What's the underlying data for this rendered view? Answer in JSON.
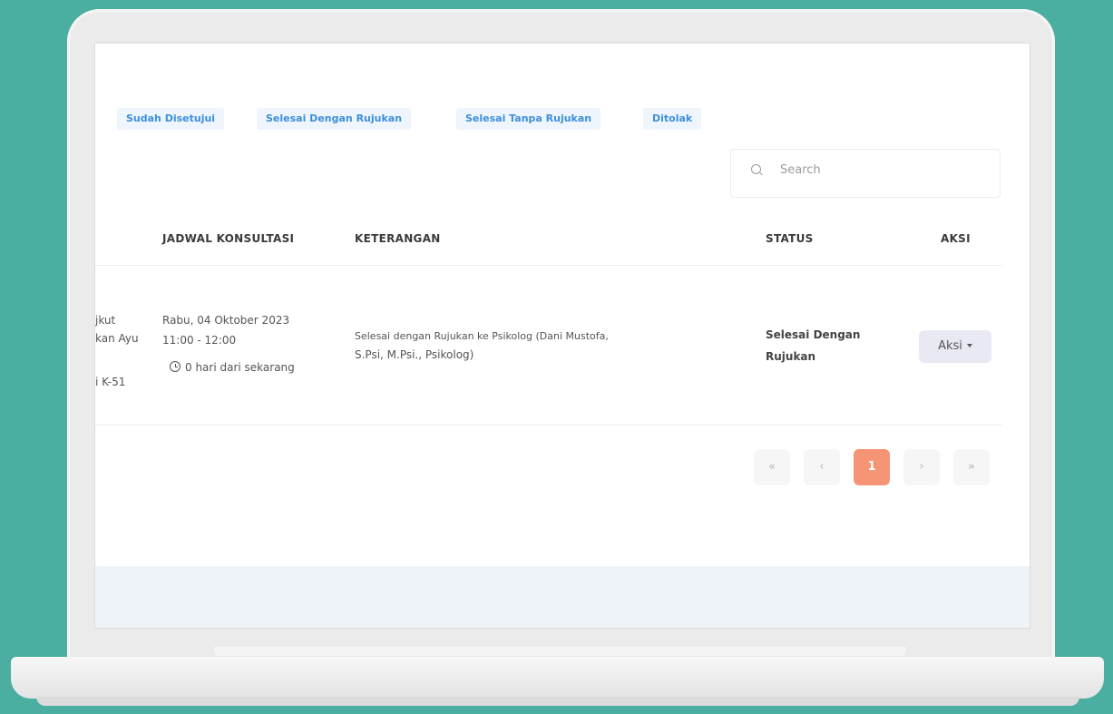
{
  "tabs": [
    "Sudah Disetujui",
    "Selesai Dengan Rujukan",
    "Selesai Tanpa Rujukan",
    "Ditolak"
  ],
  "search": {
    "placeholder": "Search",
    "icon": "search-icon"
  },
  "table": {
    "columns": [
      "JADWAL KONSULTASI",
      "KETERANGAN",
      "STATUS",
      "AKSI"
    ],
    "rows": [
      {
        "partial_left": [
          "jkut",
          "kan Ayu",
          "i K-51"
        ],
        "jadwal_date": "Rabu, 04 Oktober 2023",
        "jadwal_time": "11:00 - 12:00",
        "jadwal_relative": "0 hari dari sekarang",
        "keterangan_line1": "Selesai dengan Rujukan ke Psikolog (Dani Mustofa,",
        "keterangan_line2": "S.Psi, M.Psi., Psikolog)",
        "status_line1": "Selesai Dengan",
        "status_line2": "Rujukan",
        "action_label": "Aksi"
      }
    ]
  },
  "pagination": {
    "first": "«",
    "prev": "‹",
    "current": "1",
    "next": "›",
    "last": "»"
  },
  "colors": {
    "background": "#4aaea1",
    "tab_text": "#3d8fdc",
    "active_page": "#f59576"
  }
}
